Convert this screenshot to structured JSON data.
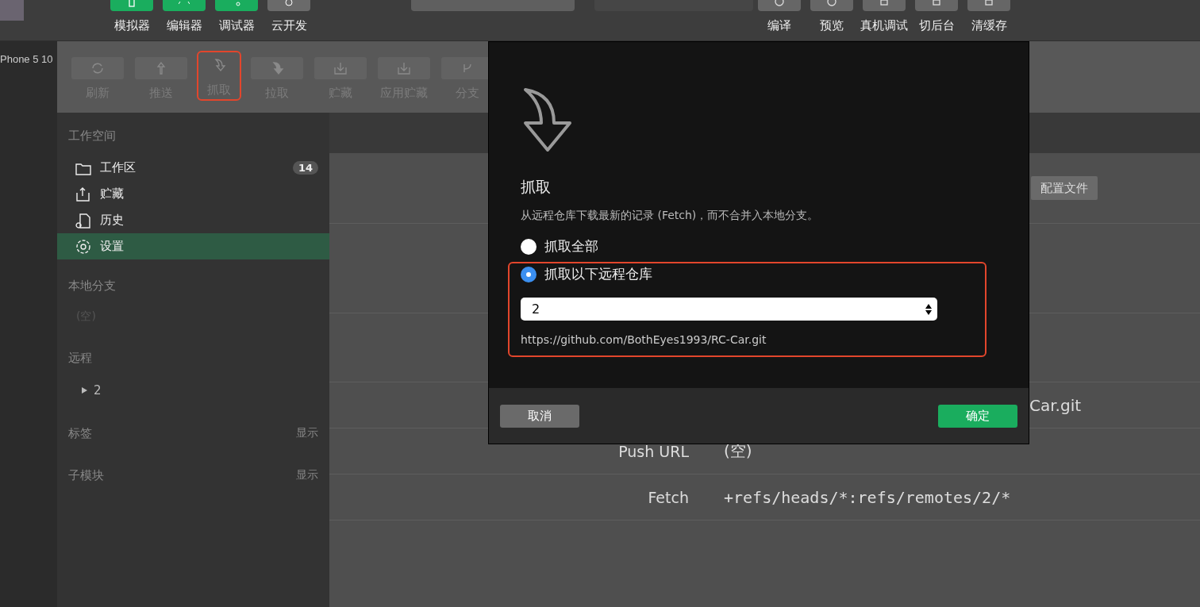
{
  "top_toolbar": {
    "left_tools": [
      {
        "label": "模拟器",
        "kind": "phone"
      },
      {
        "label": "编辑器",
        "kind": "code"
      },
      {
        "label": "调试器",
        "kind": "debug"
      },
      {
        "label": "云开发",
        "kind": "cloud"
      }
    ],
    "right_tools": [
      {
        "label": "编译",
        "kind": "refresh"
      },
      {
        "label": "预览",
        "kind": "eye"
      },
      {
        "label": "真机调试",
        "kind": "bug"
      },
      {
        "label": "切后台",
        "kind": "switch"
      },
      {
        "label": "清缓存",
        "kind": "layers"
      }
    ]
  },
  "device_label": "Phone 5 10",
  "vcs_toolbar": [
    {
      "label": "刷新",
      "kind": "refresh",
      "highlighted": false
    },
    {
      "label": "推送",
      "kind": "push",
      "highlighted": false
    },
    {
      "label": "抓取",
      "kind": "fetch",
      "highlighted": true
    },
    {
      "label": "拉取",
      "kind": "pull",
      "highlighted": false
    },
    {
      "label": "贮藏",
      "kind": "stash",
      "highlighted": false
    },
    {
      "label": "应用贮藏",
      "kind": "apply",
      "highlighted": false
    },
    {
      "label": "分支",
      "kind": "branch",
      "highlighted": false
    }
  ],
  "sidebar": {
    "workspace_title": "工作空间",
    "items": [
      {
        "label": "工作区",
        "kind": "folder",
        "badge": "14",
        "selected": false
      },
      {
        "label": "贮藏",
        "kind": "stash",
        "selected": false
      },
      {
        "label": "历史",
        "kind": "history",
        "selected": false
      },
      {
        "label": "设置",
        "kind": "gear",
        "selected": true
      }
    ],
    "sections": [
      {
        "title": "本地分支",
        "kind": "empty",
        "empty_text": "(空)"
      },
      {
        "title": "远程",
        "kind": "tree",
        "children": [
          {
            "label": "2",
            "expanded": false
          }
        ]
      },
      {
        "title": "标签",
        "kind": "toggle",
        "action": "显示"
      },
      {
        "title": "子模块",
        "kind": "toggle",
        "action": "显示"
      }
    ]
  },
  "content": {
    "tab": "配置文件",
    "rows": [
      {
        "label": "",
        "value": "Car.git",
        "kind": "covered"
      },
      {
        "label": "Push URL",
        "value": "(空)",
        "kind": "plain"
      },
      {
        "label": "Fetch",
        "value": "+refs/heads/*:refs/remotes/2/*",
        "kind": "mono"
      }
    ]
  },
  "dialog": {
    "title": "抓取",
    "description": "从远程仓库下载最新的记录 (Fetch)，而不合并入本地分支。",
    "options": [
      {
        "label": "抓取全部",
        "selected": false,
        "highlighted": false
      },
      {
        "label": "抓取以下远程仓库",
        "selected": true,
        "highlighted": true,
        "remote_select": "2",
        "remote_url": "https://github.com/BothEyes1993/RC-Car.git"
      }
    ],
    "buttons": [
      {
        "label": "取消",
        "kind": "secondary"
      },
      {
        "label": "确定",
        "kind": "primary"
      }
    ]
  }
}
